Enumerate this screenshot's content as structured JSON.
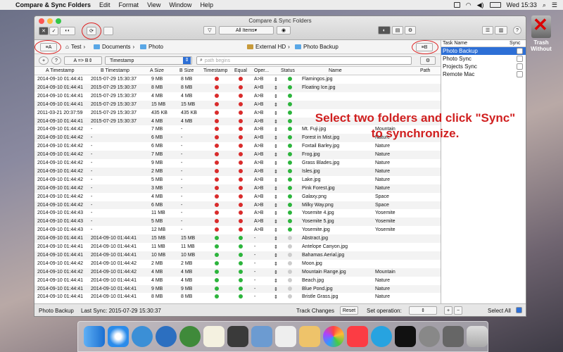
{
  "menubar": {
    "app_name": "Compare & Sync Folders",
    "items": [
      "Edit",
      "Format",
      "View",
      "Window",
      "Help"
    ],
    "clock": "Wed 15:33"
  },
  "desktop": {
    "trash_label": "Trash Without"
  },
  "window": {
    "title": "Compare & Sync Folders",
    "filter_label": "All Items"
  },
  "pathbar": {
    "side_a_label": "A",
    "side_b_label": "B",
    "a_path": [
      "Test",
      "Documents",
      "Photo"
    ],
    "b_path": [
      "External HD",
      "Photo Backup"
    ]
  },
  "controls": {
    "direction": "A => B",
    "compare_mode": "Timestamp",
    "path_placeholder": "path begins"
  },
  "table": {
    "headers": [
      "A Timestamp",
      "B Timestamp",
      "A Size",
      "B Size",
      "Timestamp",
      "Equal",
      "Oper...",
      "Status",
      "Name",
      "Path"
    ],
    "rows": [
      [
        "2014-09-10 01:44:41",
        "2015-07-29 15:30:37",
        "9 MB",
        "8 MB",
        "red",
        "red",
        "A>B",
        "green",
        "Flamingos.jpg",
        ""
      ],
      [
        "2014-09-10 01:44:41",
        "2015-07-29 15:30:37",
        "8 MB",
        "8 MB",
        "red",
        "red",
        "A>B",
        "green",
        "Floating Ice.jpg",
        ""
      ],
      [
        "2014-09-10 01:44:41",
        "2015-07-29 15:30:37",
        "4 MB",
        "4 MB",
        "red",
        "red",
        "A>B",
        "green",
        "",
        ""
      ],
      [
        "2014-09-10 01:44:41",
        "2015-07-29 15:30:37",
        "15 MB",
        "15 MB",
        "red",
        "red",
        "A>B",
        "green",
        "",
        ""
      ],
      [
        "2011-03-21 20:37:59",
        "2015-07-29 15:30:37",
        "435 KB",
        "435 KB",
        "red",
        "red",
        "A>B",
        "green",
        "",
        ""
      ],
      [
        "2014-09-10 01:44:41",
        "2015-07-29 15:30:37",
        "4 MB",
        "4 MB",
        "red",
        "red",
        "A>B",
        "green",
        "",
        ""
      ],
      [
        "2014-09-10 01:44:42",
        "-",
        "7 MB",
        "-",
        "red",
        "red",
        "A>B",
        "green",
        "Mt. Fuji.jpg",
        "Mountain"
      ],
      [
        "2014-09-10 01:44:42",
        "-",
        "6 MB",
        "-",
        "red",
        "red",
        "A>B",
        "green",
        "Forest in Mist.jpg",
        "Nature"
      ],
      [
        "2014-09-10 01:44:42",
        "-",
        "6 MB",
        "-",
        "red",
        "red",
        "A>B",
        "green",
        "Foxtail Barley.jpg",
        "Nature"
      ],
      [
        "2014-09-10 01:44:42",
        "-",
        "7 MB",
        "-",
        "red",
        "red",
        "A>B",
        "green",
        "Frog.jpg",
        "Nature"
      ],
      [
        "2014-09-10 01:44:42",
        "-",
        "9 MB",
        "-",
        "red",
        "red",
        "A>B",
        "green",
        "Grass Blades.jpg",
        "Nature"
      ],
      [
        "2014-09-10 01:44:42",
        "-",
        "2 MB",
        "-",
        "red",
        "red",
        "A>B",
        "green",
        "Isles.jpg",
        "Nature"
      ],
      [
        "2014-09-10 01:44:42",
        "-",
        "5 MB",
        "-",
        "red",
        "red",
        "A>B",
        "green",
        "Lake.jpg",
        "Nature"
      ],
      [
        "2014-09-10 01:44:42",
        "-",
        "3 MB",
        "-",
        "red",
        "red",
        "A>B",
        "green",
        "Pink Forest.jpg",
        "Nature"
      ],
      [
        "2014-09-10 01:44:42",
        "-",
        "4 MB",
        "-",
        "red",
        "red",
        "A>B",
        "green",
        "Galaxy.png",
        "Space"
      ],
      [
        "2014-09-10 01:44:42",
        "-",
        "6 MB",
        "-",
        "red",
        "red",
        "A>B",
        "green",
        "Milky Way.png",
        "Space"
      ],
      [
        "2014-09-10 01:44:43",
        "-",
        "11 MB",
        "-",
        "red",
        "red",
        "A>B",
        "green",
        "Yosemite 4.jpg",
        "Yosemite"
      ],
      [
        "2014-09-10 01:44:43",
        "-",
        "5 MB",
        "-",
        "red",
        "red",
        "A>B",
        "green",
        "Yosemite 5.jpg",
        "Yosemite"
      ],
      [
        "2014-09-10 01:44:43",
        "-",
        "12 MB",
        "-",
        "red",
        "red",
        "A>B",
        "green",
        "Yosemite.jpg",
        "Yosemite"
      ],
      [
        "2014-09-10 01:44:41",
        "2014-09-10 01:44:41",
        "15 MB",
        "15 MB",
        "green",
        "green",
        "-",
        "gray",
        "Abstract.jpg",
        ""
      ],
      [
        "2014-09-10 01:44:41",
        "2014-09-10 01:44:41",
        "11 MB",
        "11 MB",
        "green",
        "green",
        "-",
        "gray",
        "Antelope Canyon.jpg",
        ""
      ],
      [
        "2014-09-10 01:44:41",
        "2014-09-10 01:44:41",
        "10 MB",
        "10 MB",
        "green",
        "green",
        "-",
        "gray",
        "Bahamas Aerial.jpg",
        ""
      ],
      [
        "2014-09-10 01:44:42",
        "2014-09-10 01:44:42",
        "2 MB",
        "2 MB",
        "green",
        "green",
        "-",
        "gray",
        "Moon.jpg",
        ""
      ],
      [
        "2014-09-10 01:44:42",
        "2014-09-10 01:44:42",
        "4 MB",
        "4 MB",
        "green",
        "green",
        "-",
        "gray",
        "Mountain Range.jpg",
        "Mountain"
      ],
      [
        "2014-09-10 01:44:41",
        "2014-09-10 01:44:41",
        "4 MB",
        "4 MB",
        "green",
        "green",
        "-",
        "gray",
        "Beach.jpg",
        "Nature"
      ],
      [
        "2014-09-10 01:44:41",
        "2014-09-10 01:44:41",
        "9 MB",
        "9 MB",
        "green",
        "green",
        "-",
        "gray",
        "Blue Pond.jpg",
        "Nature"
      ],
      [
        "2014-09-10 01:44:41",
        "2014-09-10 01:44:41",
        "8 MB",
        "8 MB",
        "green",
        "green",
        "-",
        "gray",
        "Bristle Grass.jpg",
        "Nature"
      ]
    ]
  },
  "overlay_text": [
    "Select two folders and click \"Sync\"",
    "to synchronize."
  ],
  "sidebar": {
    "task_name_header": "Task Name",
    "sync_header": "Sync",
    "tasks": [
      "Photo Backup",
      "Photo Sync",
      "Projects Sync",
      "Remote Mac"
    ]
  },
  "statusbar": {
    "task": "Photo Backup",
    "last_sync": "Last Sync: 2015-07-29 15:30:37",
    "track_changes": "Track Changes",
    "reset": "Reset",
    "set_operation": "Set operation:",
    "select_all": "Select All"
  },
  "colors": {
    "accent": "#2d6fd6",
    "ring": "#d22222",
    "status_red": "#d92b2b",
    "status_green": "#2cb43c"
  }
}
